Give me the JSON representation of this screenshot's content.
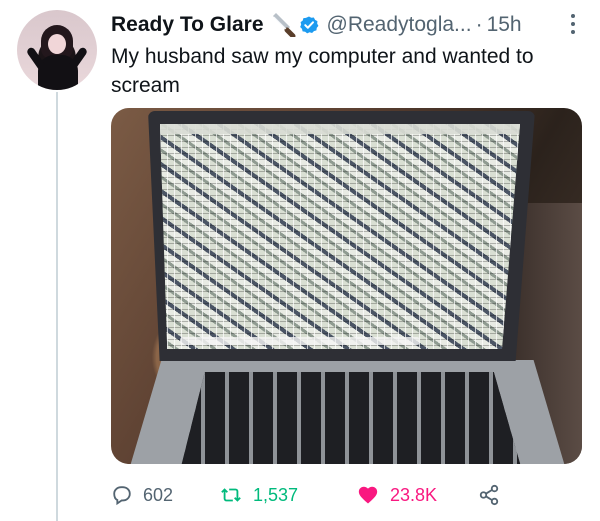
{
  "tweet": {
    "author_name": "Ready To Glare",
    "handle": "@Readytogla...",
    "separator": "·",
    "time": "15h",
    "text": "My husband saw my computer and wanted to scream",
    "media_alt": "Photo of a laptop screen filled with many overlapping windows"
  },
  "icons": {
    "knife": "knife-icon",
    "verified": "verified-icon",
    "more": "more-icon",
    "reply": "reply-icon",
    "retweet": "retweet-icon",
    "like": "heart-icon",
    "share": "share-icon"
  },
  "actions": {
    "reply_count": "602",
    "retweet_count": "1,537",
    "like_count": "23.8K"
  },
  "colors": {
    "text": "#0f1419",
    "secondary": "#536471",
    "verified": "#1d9bf0",
    "retweet": "#00ba7c",
    "like": "#f91880"
  }
}
